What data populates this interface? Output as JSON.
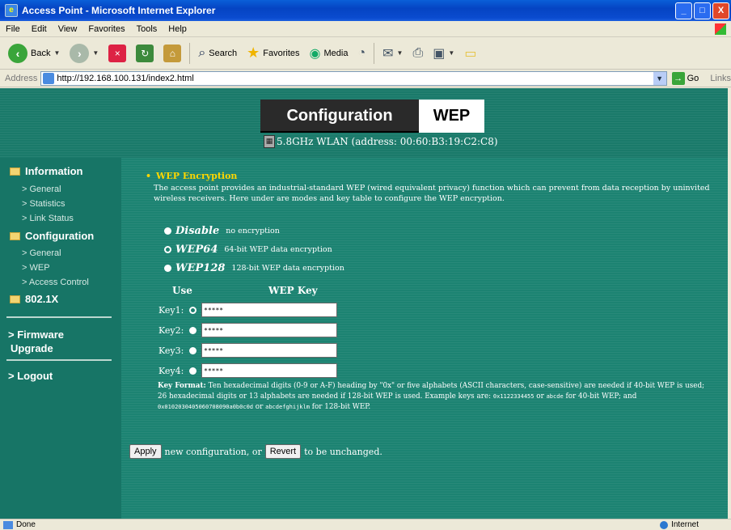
{
  "window": {
    "title": "Access Point - Microsoft Internet Explorer",
    "min": "_",
    "max": "□",
    "close": "X"
  },
  "menu": [
    "File",
    "Edit",
    "View",
    "Favorites",
    "Tools",
    "Help"
  ],
  "toolbar": {
    "back": "Back",
    "search": "Search",
    "favorites": "Favorites",
    "media": "Media"
  },
  "address": {
    "label": "Address",
    "url": "http://192.168.100.131/index2.html",
    "go": "Go",
    "links": "Links"
  },
  "header": {
    "config": "Configuration",
    "page": "WEP",
    "wlan": "5.8GHz WLAN (address: 00:60:B3:19:C2:C8)"
  },
  "sidebar": {
    "information": "Information",
    "info_items": [
      "> General",
      "> Statistics",
      "> Link Status"
    ],
    "configuration": "Configuration",
    "config_items": [
      "> General",
      "> WEP",
      "> Access Control"
    ],
    "dot1x": "802.1X",
    "firmware": "> Firmware",
    "upgrade": "Upgrade",
    "logout": "> Logout"
  },
  "main": {
    "section_title": "WEP Encryption",
    "description": "The access point provides an industrial-standard WEP (wired equivalent privacy) function which can prevent from data reception by uninvited wireless receivers. Here under are modes and key table to configure the WEP encryption.",
    "modes": [
      {
        "name": "Disable",
        "desc": "no encryption",
        "selected": false
      },
      {
        "name": "WEP64",
        "desc": "64-bit WEP data encryption",
        "selected": true
      },
      {
        "name": "WEP128",
        "desc": "128-bit WEP data encryption",
        "selected": false
      }
    ],
    "col_use": "Use",
    "col_key": "WEP Key",
    "keys": [
      {
        "label": "Key1:",
        "value": "*****",
        "selected": true
      },
      {
        "label": "Key2:",
        "value": "*****",
        "selected": false
      },
      {
        "label": "Key3:",
        "value": "*****",
        "selected": false
      },
      {
        "label": "Key4:",
        "value": "*****",
        "selected": false
      }
    ],
    "keyformat": {
      "label": "Key Format:",
      "text1": " Ten hexadecimal digits (0-9 or A-F) heading by \"0x\" or five alphabets (ASCII characters, case-sensitive) are needed if 40-bit WEP is used; 26 hexadecimal digits or 13 alphabets are needed if 128-bit WEP is used. Example keys are: ",
      "ex1": "0x1122334455",
      "or1": " or ",
      "ex2": "abcde",
      "text2": " for 40-bit WEP; and ",
      "ex3": "0x0102030405060708090a0b0c0d",
      "or2": " or ",
      "ex4": "abcdefghijklm",
      "text3": " for 128-bit WEP."
    },
    "apply": "Apply",
    "apply_text": "new configuration, or",
    "revert": "Revert",
    "revert_text": "to be unchanged."
  },
  "status": {
    "left": "Done",
    "zone": "Internet"
  },
  "colors": {
    "page_bg": "#1c8372",
    "title_yellow": "#ffd700",
    "titlebar_blue": "#0a5fd8"
  }
}
